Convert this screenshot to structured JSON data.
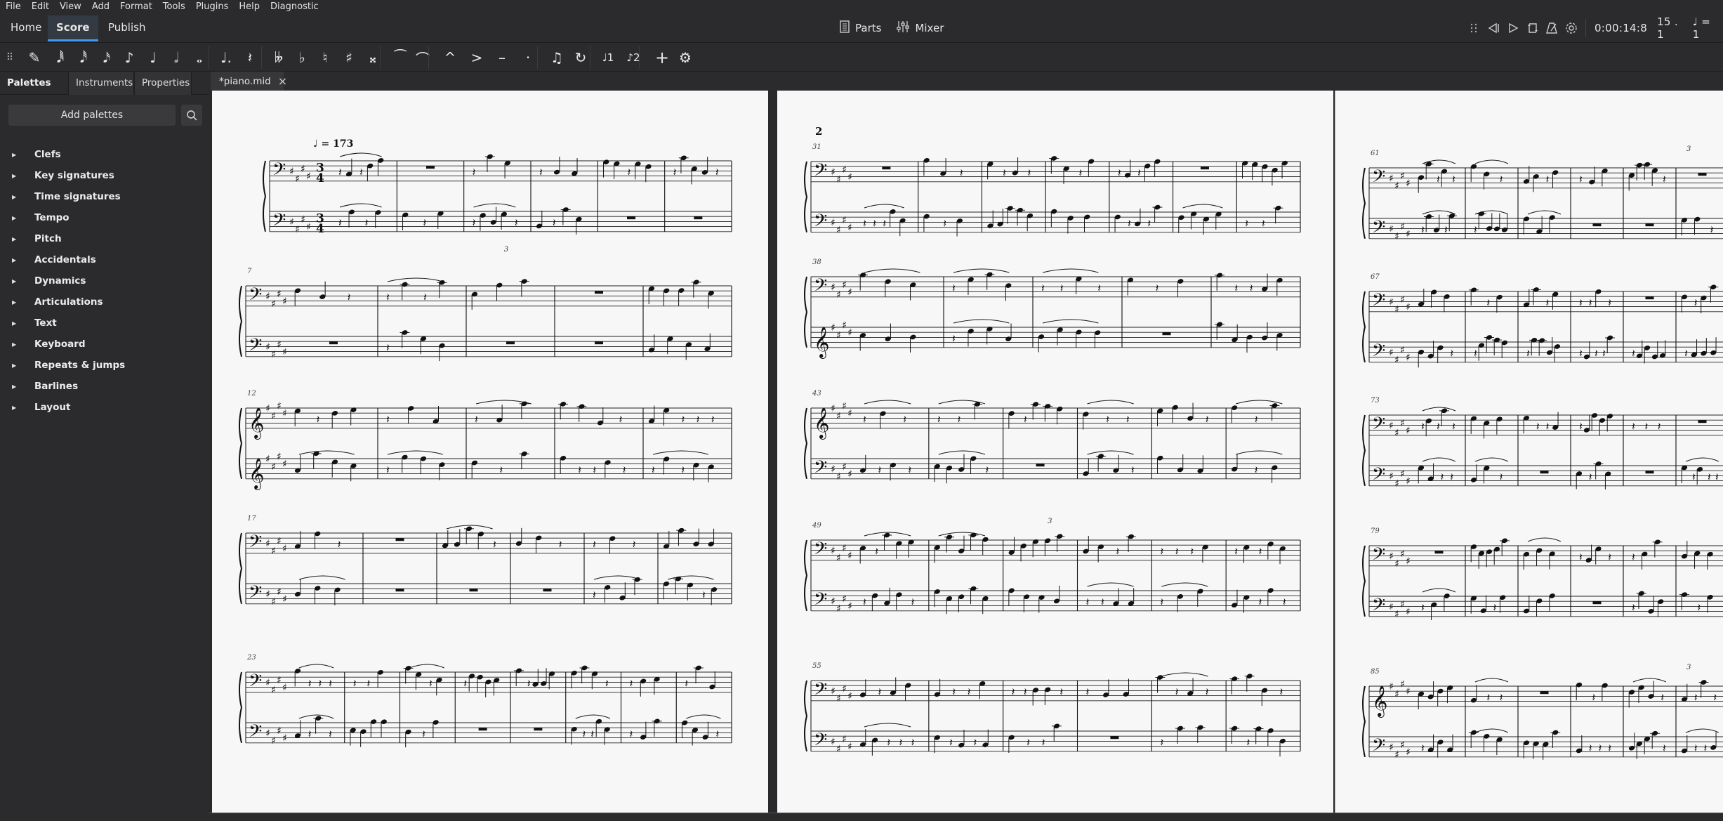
{
  "menu": [
    "File",
    "Edit",
    "View",
    "Add",
    "Format",
    "Tools",
    "Plugins",
    "Help",
    "Diagnostic"
  ],
  "workspace_tabs": [
    {
      "label": "Home",
      "active": false
    },
    {
      "label": "Score",
      "active": true
    },
    {
      "label": "Publish",
      "active": false
    }
  ],
  "center_tools": {
    "parts_label": "Parts",
    "parts_icon": "parts-icon",
    "mixer_label": "Mixer",
    "mixer_icon": "mixer-icon"
  },
  "playback": {
    "buttons": [
      "grip-icon",
      "rewind-icon",
      "play-icon",
      "loop-icon",
      "metronome-icon",
      "playback-settings-icon"
    ],
    "time": "0:00:14:8",
    "position": "15 . 1",
    "tempo": "♩ = 1"
  },
  "note_input_toolbar": [
    {
      "name": "grip-icon",
      "glyph": "⠿"
    },
    {
      "name": "note-input-pencil-icon",
      "glyph": "✎"
    },
    {
      "name": "64th-note-icon",
      "glyph": "𝅘𝅥𝅱"
    },
    {
      "name": "32nd-note-icon",
      "glyph": "𝅘𝅥𝅰"
    },
    {
      "name": "16th-note-icon",
      "glyph": "𝅘𝅥𝅯"
    },
    {
      "name": "eighth-note-icon",
      "glyph": "♪"
    },
    {
      "name": "quarter-note-icon",
      "glyph": "♩"
    },
    {
      "name": "half-note-icon",
      "glyph": "𝅗𝅥"
    },
    {
      "name": "whole-note-icon",
      "glyph": "𝅝"
    },
    {
      "name": "augmentation-dot-icon",
      "glyph": "♩."
    },
    {
      "name": "rest-icon",
      "glyph": "𝄽"
    },
    {
      "name": "double-flat-icon",
      "glyph": "𝄫"
    },
    {
      "name": "flat-icon",
      "glyph": "♭"
    },
    {
      "name": "natural-icon",
      "glyph": "♮"
    },
    {
      "name": "sharp-icon",
      "glyph": "♯"
    },
    {
      "name": "double-sharp-icon",
      "glyph": "𝄪"
    },
    {
      "name": "tie-icon",
      "glyph": "⁀"
    },
    {
      "name": "slur-icon",
      "glyph": "⌒"
    },
    {
      "name": "marcato-icon",
      "glyph": "^"
    },
    {
      "name": "accent-icon",
      "glyph": ">"
    },
    {
      "name": "tenuto-icon",
      "glyph": "–"
    },
    {
      "name": "staccato-icon",
      "glyph": "·"
    },
    {
      "name": "tuplet-icon",
      "glyph": "♫"
    },
    {
      "name": "flip-direction-icon",
      "glyph": "↻"
    },
    {
      "name": "voice-1-icon",
      "glyph": "♩1"
    },
    {
      "name": "voice-2-icon",
      "glyph": "♪2"
    },
    {
      "name": "add-icon",
      "glyph": "+"
    },
    {
      "name": "customize-toolbar-icon",
      "glyph": "⚙"
    }
  ],
  "sidebar": {
    "tabs": [
      {
        "label": "Palettes",
        "active": true,
        "menu": "···"
      },
      {
        "label": "Instruments",
        "active": false
      },
      {
        "label": "Properties",
        "active": false
      }
    ],
    "add_palettes_label": "Add palettes",
    "palettes": [
      "Clefs",
      "Key signatures",
      "Time signatures",
      "Tempo",
      "Pitch",
      "Accidentals",
      "Dynamics",
      "Articulations",
      "Text",
      "Keyboard",
      "Repeats & jumps",
      "Barlines",
      "Layout"
    ]
  },
  "document_tab": {
    "label": "*piano.mid",
    "close": "×"
  },
  "score": {
    "tempo_marking": "♩ = 173",
    "time_signature": [
      "3",
      "4"
    ],
    "key_signature_sharps": 4,
    "pages": [
      {
        "page_number": "",
        "systems": [
          {
            "start_measure": "",
            "measures": 6,
            "clefs": [
              "bass",
              "bass"
            ],
            "first": true,
            "triplet_label": "3"
          },
          {
            "start_measure": "7",
            "measures": 5,
            "clefs": [
              "bass",
              "bass"
            ]
          },
          {
            "start_measure": "12",
            "measures": 5,
            "clefs": [
              "treble",
              "treble"
            ]
          },
          {
            "start_measure": "17",
            "measures": 6,
            "clefs": [
              "bass",
              "bass"
            ]
          },
          {
            "start_measure": "23",
            "measures": 8,
            "clefs": [
              "bass",
              "bass"
            ]
          }
        ]
      },
      {
        "page_number": "2",
        "systems": [
          {
            "start_measure": "31",
            "measures": 7,
            "clefs": [
              "bass",
              "bass"
            ]
          },
          {
            "start_measure": "38",
            "measures": 5,
            "clefs": [
              "bass",
              "treble"
            ]
          },
          {
            "start_measure": "43",
            "measures": 6,
            "clefs": [
              "treble",
              "bass"
            ]
          },
          {
            "start_measure": "49",
            "measures": 6,
            "clefs": [
              "bass",
              "bass"
            ],
            "triplet_label": "3"
          },
          {
            "start_measure": "55",
            "measures": 6,
            "clefs": [
              "bass",
              "bass"
            ]
          }
        ]
      },
      {
        "page_number": "",
        "systems": [
          {
            "start_measure": "61",
            "measures": 6,
            "clefs": [
              "bass",
              "bass"
            ],
            "triplet_label": "3"
          },
          {
            "start_measure": "67",
            "measures": 6,
            "clefs": [
              "bass",
              "bass"
            ]
          },
          {
            "start_measure": "73",
            "measures": 6,
            "clefs": [
              "bass",
              "bass"
            ]
          },
          {
            "start_measure": "79",
            "measures": 6,
            "clefs": [
              "bass",
              "bass"
            ]
          },
          {
            "start_measure": "85",
            "measures": 6,
            "clefs": [
              "treble",
              "bass"
            ],
            "triplet_label": "3"
          }
        ]
      }
    ]
  },
  "colors": {
    "accent": "#3c9bf0",
    "ui_bg": "#2b2b2e",
    "page_bg": "#f7f7f7",
    "ink": "#111111"
  }
}
